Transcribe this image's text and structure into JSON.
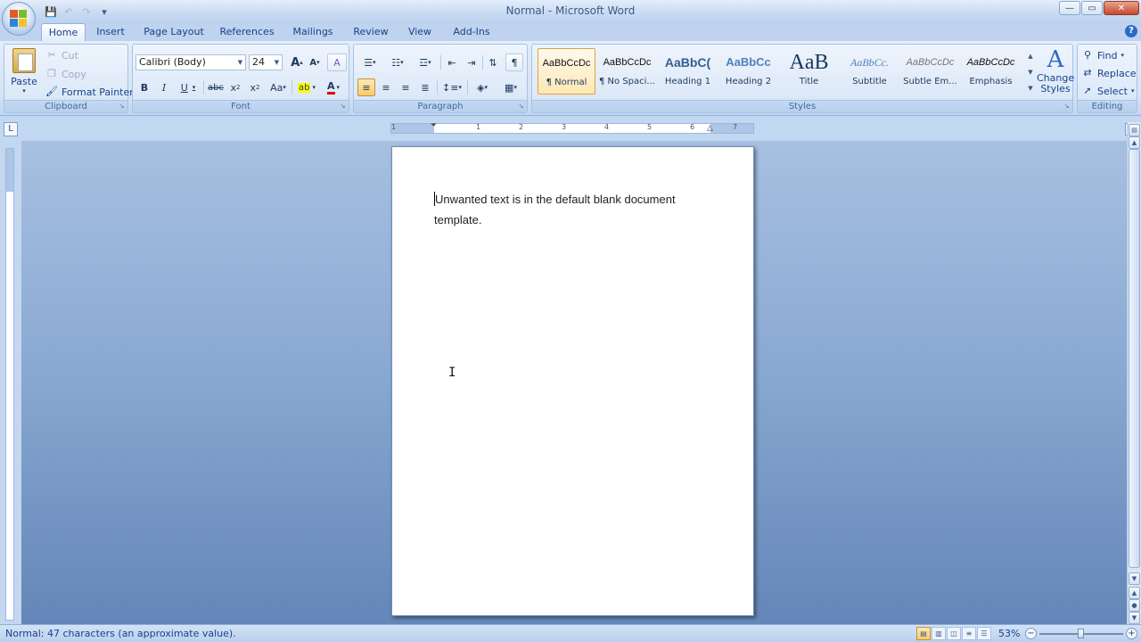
{
  "window": {
    "title": "Normal - Microsoft Word",
    "minimize_icon": "minimize-icon",
    "maximize_icon": "restore-icon",
    "close_icon": "close-icon",
    "minimize_glyph": "—",
    "restore_glyph": "▭",
    "close_glyph": "✕"
  },
  "quick_access": {
    "save_glyph": "💾",
    "undo_glyph": "↶",
    "redo_glyph": "↷",
    "customize_glyph": "▾"
  },
  "tabs": [
    "Home",
    "Insert",
    "Page Layout",
    "References",
    "Mailings",
    "Review",
    "View",
    "Add-Ins"
  ],
  "active_tab": "Home",
  "help_glyph": "?",
  "clipboard": {
    "label": "Clipboard",
    "paste": "Paste",
    "cut": "Cut",
    "copy": "Copy",
    "format_painter": "Format Painter"
  },
  "font": {
    "label": "Font",
    "font_name": "Calibri (Body)",
    "font_size": "24",
    "grow": "A",
    "shrink": "A",
    "clear": "A",
    "bold": "B",
    "italic": "I",
    "underline": "U",
    "strike": "abc",
    "subscript": "x",
    "superscript": "x",
    "change_case": "Aa",
    "highlight": "ab",
    "font_color": "A"
  },
  "paragraph": {
    "label": "Paragraph",
    "show_marks": "¶"
  },
  "styles": {
    "label": "Styles",
    "tiles": [
      {
        "sample": "AaBbCcDc",
        "name": "¶ Normal"
      },
      {
        "sample": "AaBbCcDc",
        "name": "¶ No Spaci..."
      },
      {
        "sample": "AaBbC(",
        "name": "Heading 1"
      },
      {
        "sample": "AaBbCc",
        "name": "Heading 2"
      },
      {
        "sample": "AaB",
        "name": "Title"
      },
      {
        "sample": "AaBbCc.",
        "name": "Subtitle"
      },
      {
        "sample": "AaBbCcDc",
        "name": "Subtle Em..."
      },
      {
        "sample": "AaBbCcDc",
        "name": "Emphasis"
      }
    ],
    "change_styles": "Change Styles",
    "change_styles_glyph": "A"
  },
  "editing": {
    "label": "Editing",
    "find": "Find",
    "replace": "Replace",
    "select": "Select"
  },
  "ruler": {
    "numbers": [
      "1",
      "1",
      "2",
      "3",
      "4",
      "5",
      "6",
      "7"
    ]
  },
  "document": {
    "text": "Unwanted text is in the default blank document template."
  },
  "status": {
    "text": "Normal: 47 characters (an approximate value).",
    "zoom": "53%",
    "zoom_fraction": 0.5
  },
  "colors": {
    "accent": "#15428b",
    "ribbon_bg": "#dde9f8",
    "doc_bg": "#8baad3"
  }
}
